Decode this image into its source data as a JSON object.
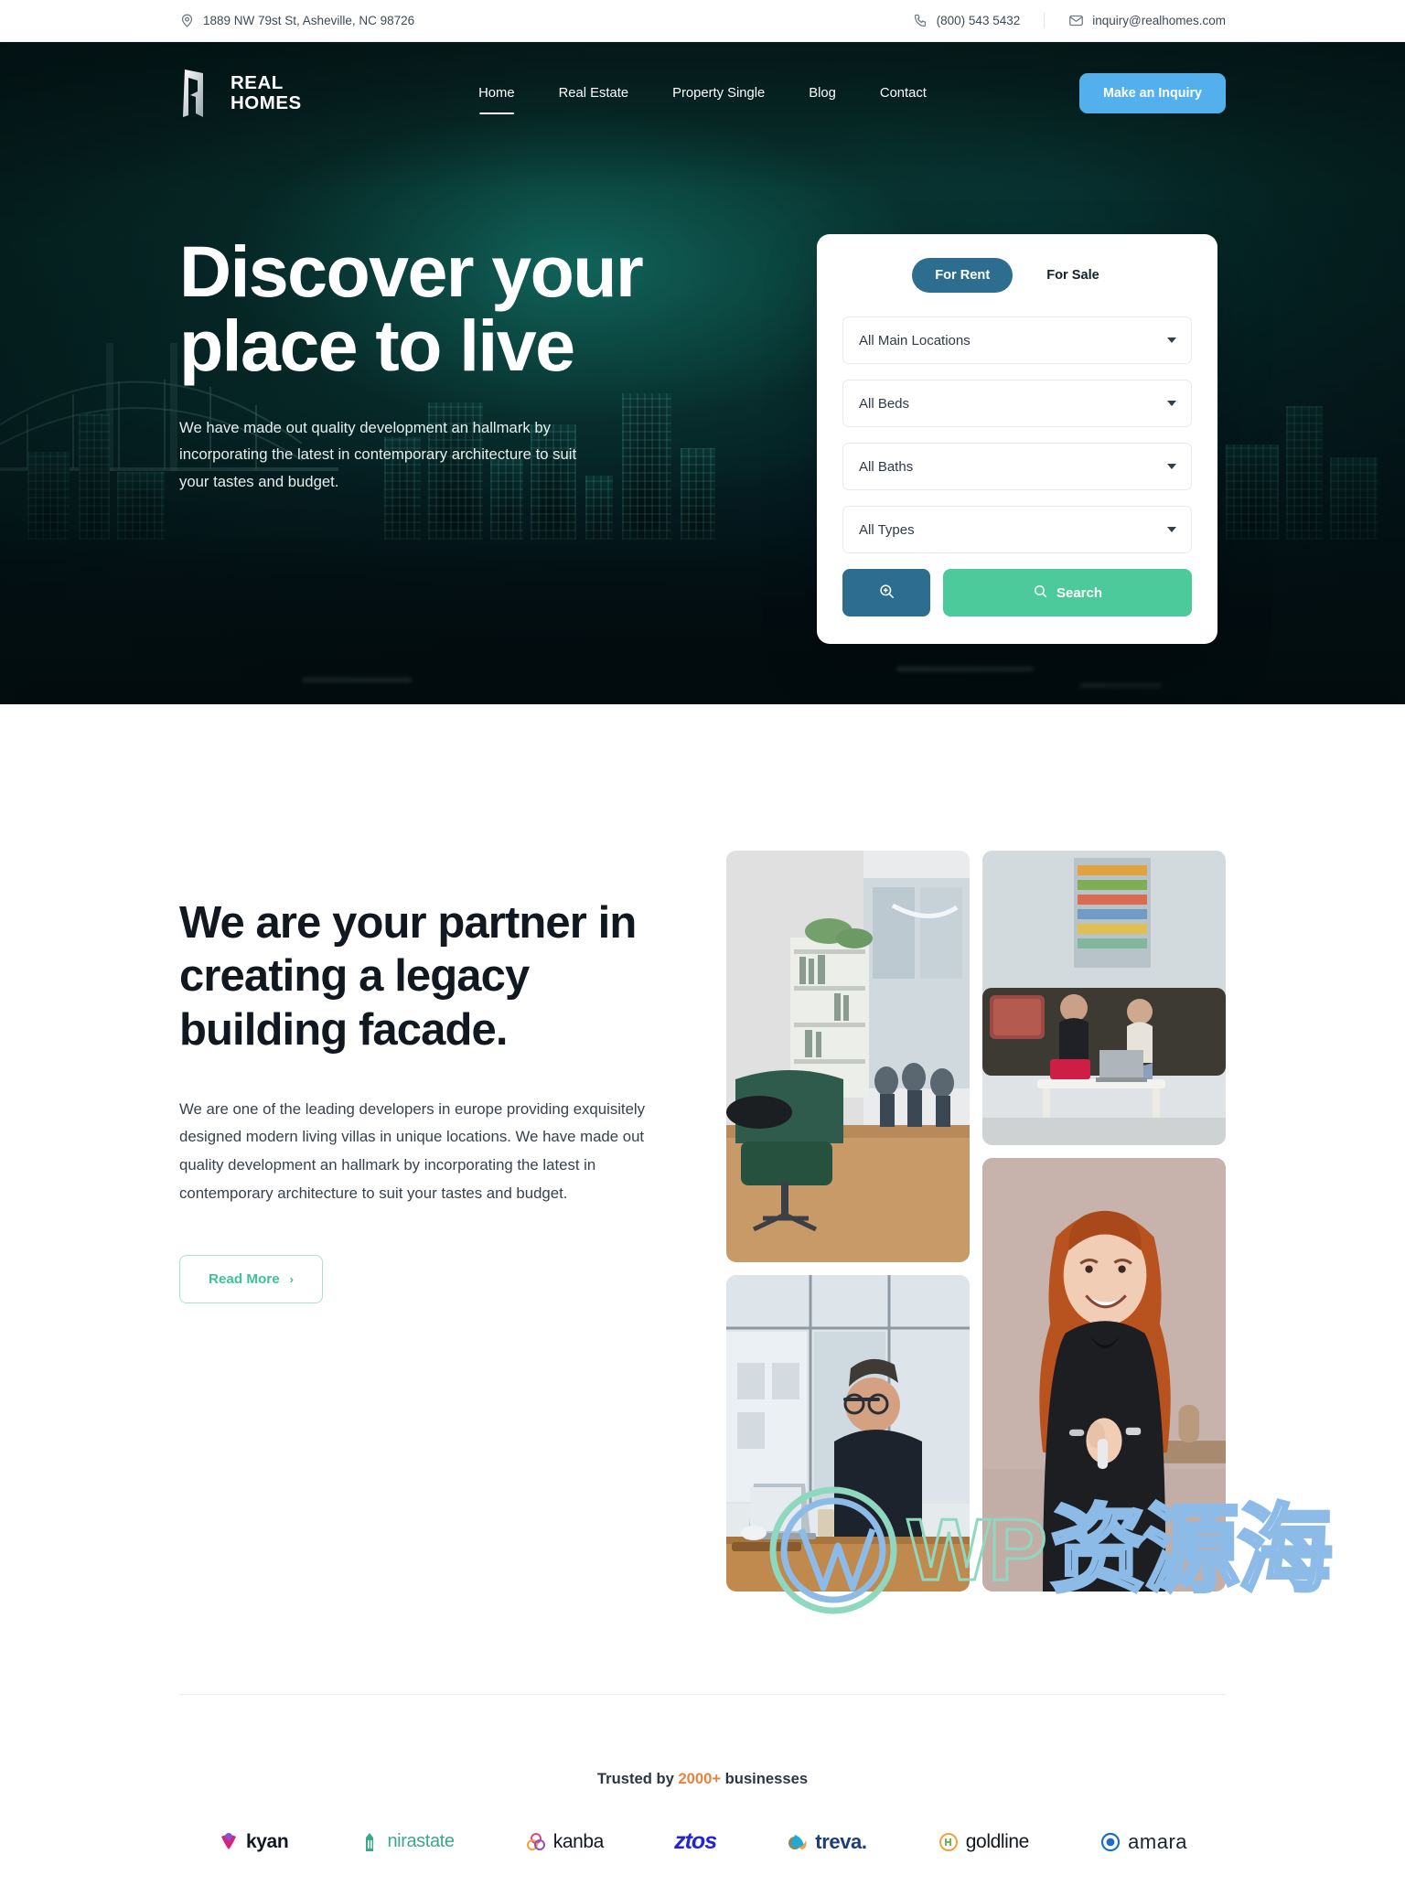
{
  "topbar": {
    "address": "1889 NW 79st St, Asheville, NC 98726",
    "phone": "(800) 543 5432",
    "email": "inquiry@realhomes.com",
    "location_icon": "map-pin-icon",
    "phone_icon": "phone-icon",
    "email_icon": "envelope-icon"
  },
  "nav": {
    "brand_line1": "REAL",
    "brand_line2": "HOMES",
    "links": [
      {
        "label": "Home",
        "active": true
      },
      {
        "label": "Real Estate",
        "active": false
      },
      {
        "label": "Property Single",
        "active": false
      },
      {
        "label": "Blog",
        "active": false
      },
      {
        "label": "Contact",
        "active": false
      }
    ],
    "cta_label": "Make an Inquiry",
    "cta_color": "#53b0ec"
  },
  "hero": {
    "title_line1": "Discover your",
    "title_line2": "place to live",
    "subtitle": "We have made out quality development an hallmark by incorporating the latest in contemporary architecture to suit your tastes and budget."
  },
  "search": {
    "tabs": [
      {
        "label": "For Rent",
        "active": true
      },
      {
        "label": "For Sale",
        "active": false
      }
    ],
    "active_tab_color": "#2d6e90",
    "fields": [
      {
        "name": "location",
        "value": "All Main Locations"
      },
      {
        "name": "beds",
        "value": "All Beds"
      },
      {
        "name": "baths",
        "value": "All Baths"
      },
      {
        "name": "types",
        "value": "All Types"
      }
    ],
    "advanced_icon": "zoom-in-icon",
    "search_label": "Search",
    "search_icon": "search-icon",
    "search_color": "#4cca9c"
  },
  "about": {
    "title": "We are your partner in creating a legacy building facade.",
    "paragraph": "We are one of the leading developers in europe providing exquisitely designed modern living villas in unique locations. We have made out quality development an hallmark by incorporating the latest in contemporary architecture to suit your tastes and budget.",
    "button_label": "Read More",
    "button_chevron": "›",
    "button_color": "#3fc396",
    "images": [
      {
        "name": "office-lounge-photo"
      },
      {
        "name": "couple-on-sofa-photo"
      },
      {
        "name": "man-at-laptop-photo"
      },
      {
        "name": "smiling-woman-photo"
      }
    ]
  },
  "trust": {
    "prefix": "Trusted by ",
    "highlight": "2000+",
    "suffix": " businesses",
    "highlight_color": "#e8833f",
    "logos": [
      {
        "name": "kyan",
        "label": "kyan"
      },
      {
        "name": "nirastate",
        "label": "nirastate"
      },
      {
        "name": "kanba",
        "label": "kanba"
      },
      {
        "name": "ztos",
        "label": "ztos"
      },
      {
        "name": "treva",
        "label": "treva."
      },
      {
        "name": "goldline",
        "label": "goldline"
      },
      {
        "name": "amara",
        "label": "amara"
      }
    ]
  },
  "watermark": {
    "latin": "WP",
    "cjk": "资源海"
  }
}
